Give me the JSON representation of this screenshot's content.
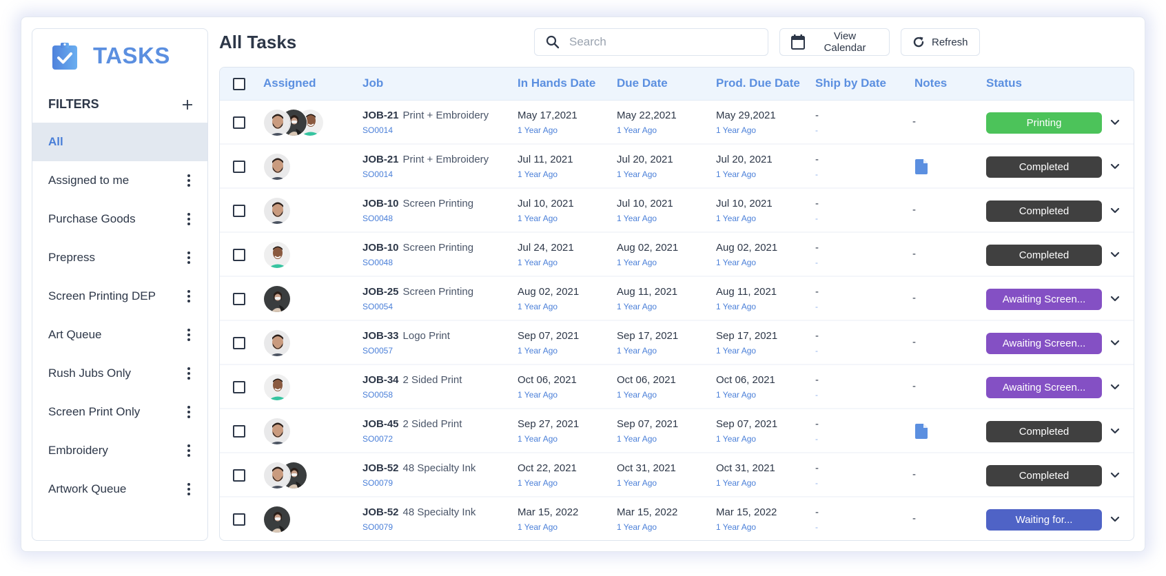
{
  "app": {
    "logo_text": "TASKS",
    "page_title": "All Tasks"
  },
  "colors": {
    "brand": "#5b8fe0",
    "status_printing": "#4cc35a",
    "status_completed": "#404040",
    "status_awaiting": "#8450c4",
    "status_waiting": "#4f63c6"
  },
  "sidebar": {
    "filters_title": "FILTERS",
    "add_icon": "plus-icon",
    "items": [
      {
        "label": "All",
        "active": true
      },
      {
        "label": "Assigned to me"
      },
      {
        "label": "Purchase Goods"
      },
      {
        "label": "Prepress"
      },
      {
        "label": "Screen Printing DEP"
      },
      {
        "label": "Art Queue"
      },
      {
        "label": "Rush Jubs Only"
      },
      {
        "label": "Screen Print Only"
      },
      {
        "label": "Embroidery"
      },
      {
        "label": "Artwork Queue"
      }
    ]
  },
  "toolbar": {
    "search_placeholder": "Search",
    "search_value": "",
    "view_calendar_label": "View Calendar",
    "refresh_label": "Refresh"
  },
  "table": {
    "columns": [
      "Assigned",
      "Job",
      "In Hands Date",
      "Due Date",
      "Prod. Due Date",
      "Ship by Date",
      "Notes",
      "Status"
    ],
    "rows": [
      {
        "avatars": [
          "man-beard",
          "woman-mask",
          "man-green"
        ],
        "job_id": "JOB-21",
        "job_name": "Print + Embroidery",
        "so": "SO0014",
        "in_hands": "May 17,2021",
        "in_hands_rel": "1 Year Ago",
        "due": "May 22,2021",
        "due_rel": "1 Year Ago",
        "prod_due": "May 29,2021",
        "prod_due_rel": "1 Year Ago",
        "ship": "-",
        "ship_rel": "-",
        "notes": "-",
        "has_note_file": false,
        "status": "Printing",
        "status_kind": "printing"
      },
      {
        "avatars": [
          "man-beard"
        ],
        "job_id": "JOB-21",
        "job_name": "Print + Embroidery",
        "so": "SO0014",
        "in_hands": "Jul 11, 2021",
        "in_hands_rel": "1 Year Ago",
        "due": "Jul 20, 2021",
        "due_rel": "1 Year Ago",
        "prod_due": "Jul 20, 2021",
        "prod_due_rel": "1 Year Ago",
        "ship": "-",
        "ship_rel": "-",
        "notes": "",
        "has_note_file": true,
        "status": "Completed",
        "status_kind": "completed"
      },
      {
        "avatars": [
          "man-beard"
        ],
        "job_id": "JOB-10",
        "job_name": "Screen Printing",
        "so": "SO0048",
        "in_hands": "Jul 10, 2021",
        "in_hands_rel": "1 Year Ago",
        "due": "Jul 10, 2021",
        "due_rel": "1 Year Ago",
        "prod_due": "Jul 10, 2021",
        "prod_due_rel": "1 Year Ago",
        "ship": "-",
        "ship_rel": "-",
        "notes": "-",
        "has_note_file": false,
        "status": "Completed",
        "status_kind": "completed"
      },
      {
        "avatars": [
          "man-green"
        ],
        "job_id": "JOB-10",
        "job_name": "Screen Printing",
        "so": "SO0048",
        "in_hands": "Jul 24, 2021",
        "in_hands_rel": "1 Year Ago",
        "due": "Aug 02, 2021",
        "due_rel": "1 Year Ago",
        "prod_due": "Aug 02, 2021",
        "prod_due_rel": "1 Year Ago",
        "ship": "-",
        "ship_rel": "-",
        "notes": "-",
        "has_note_file": false,
        "status": "Completed",
        "status_kind": "completed"
      },
      {
        "avatars": [
          "woman-mask"
        ],
        "job_id": "JOB-25",
        "job_name": "Screen Printing",
        "so": "SO0054",
        "in_hands": "Aug 02, 2021",
        "in_hands_rel": "1 Year Ago",
        "due": "Aug 11, 2021",
        "due_rel": "1 Year Ago",
        "prod_due": "Aug 11, 2021",
        "prod_due_rel": "1 Year Ago",
        "ship": "-",
        "ship_rel": "-",
        "notes": "-",
        "has_note_file": false,
        "status": "Awaiting Screen...",
        "status_kind": "awaiting"
      },
      {
        "avatars": [
          "man-beard"
        ],
        "job_id": "JOB-33",
        "job_name": "Logo Print",
        "so": "SO0057",
        "in_hands": "Sep 07, 2021",
        "in_hands_rel": "1 Year Ago",
        "due": "Sep 17, 2021",
        "due_rel": "1 Year Ago",
        "prod_due": "Sep 17, 2021",
        "prod_due_rel": "1 Year Ago",
        "ship": "-",
        "ship_rel": "-",
        "notes": "-",
        "has_note_file": false,
        "status": "Awaiting Screen...",
        "status_kind": "awaiting"
      },
      {
        "avatars": [
          "man-green"
        ],
        "job_id": "JOB-34",
        "job_name": "2 Sided Print",
        "so": "SO0058",
        "in_hands": "Oct 06, 2021",
        "in_hands_rel": "1 Year Ago",
        "due": "Oct 06, 2021",
        "due_rel": "1 Year Ago",
        "prod_due": "Oct 06, 2021",
        "prod_due_rel": "1 Year Ago",
        "ship": "-",
        "ship_rel": "-",
        "notes": "-",
        "has_note_file": false,
        "status": "Awaiting Screen...",
        "status_kind": "awaiting"
      },
      {
        "avatars": [
          "man-beard"
        ],
        "job_id": "JOB-45",
        "job_name": "2 Sided Print",
        "so": "SO0072",
        "in_hands": "Sep 27, 2021",
        "in_hands_rel": "1 Year Ago",
        "due": "Sep 07, 2021",
        "due_rel": "1 Year Ago",
        "prod_due": "Sep 07, 2021",
        "prod_due_rel": "1 Year Ago",
        "ship": "-",
        "ship_rel": "-",
        "notes": "",
        "has_note_file": true,
        "status": "Completed",
        "status_kind": "completed"
      },
      {
        "avatars": [
          "man-beard",
          "woman-mask"
        ],
        "job_id": "JOB-52",
        "job_name": "48 Specialty Ink",
        "so": "SO0079",
        "in_hands": "Oct 22, 2021",
        "in_hands_rel": "1 Year Ago",
        "due": "Oct 31, 2021",
        "due_rel": "1 Year Ago",
        "prod_due": "Oct 31, 2021",
        "prod_due_rel": "1 Year Ago",
        "ship": "-",
        "ship_rel": "-",
        "notes": "-",
        "has_note_file": false,
        "status": "Completed",
        "status_kind": "completed"
      },
      {
        "avatars": [
          "woman-mask"
        ],
        "job_id": "JOB-52",
        "job_name": "48 Specialty Ink",
        "so": "SO0079",
        "in_hands": "Mar 15, 2022",
        "in_hands_rel": "1 Year Ago",
        "due": "Mar 15, 2022",
        "due_rel": "1 Year Ago",
        "prod_due": "Mar 15, 2022",
        "prod_due_rel": "1 Year Ago",
        "ship": "-",
        "ship_rel": "-",
        "notes": "-",
        "has_note_file": false,
        "status": "Waiting for...",
        "status_kind": "waiting"
      }
    ]
  }
}
